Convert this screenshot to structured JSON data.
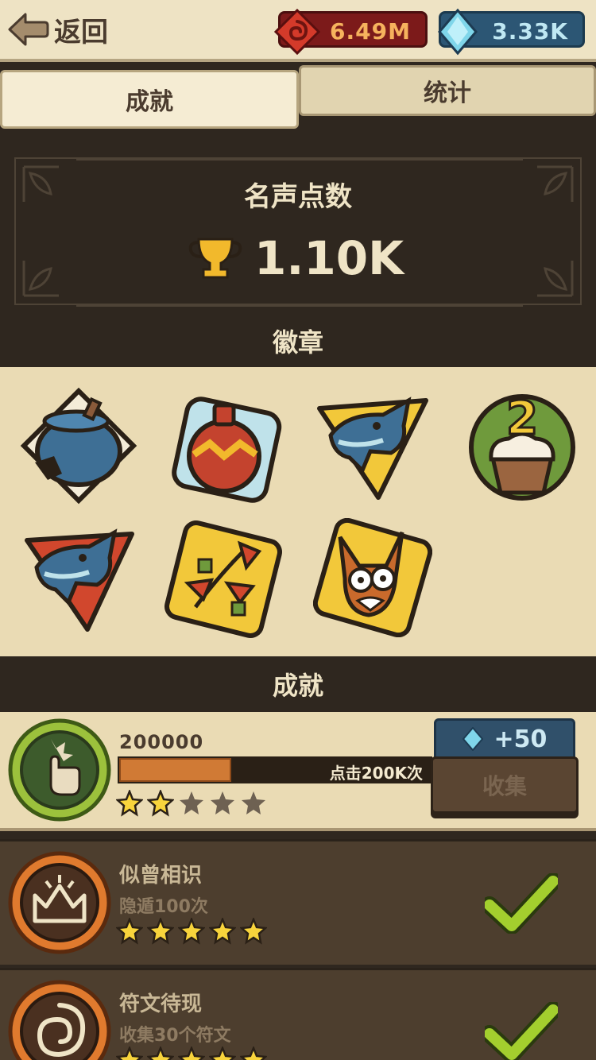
{
  "topbar": {
    "back_label": "返回",
    "currency_red": {
      "value": "6.49M",
      "icon": "red-rune-icon",
      "color": "#7c1a1a"
    },
    "currency_blue": {
      "value": "3.33K",
      "icon": "gem-icon",
      "color": "#2c5674"
    }
  },
  "tabs": [
    {
      "label": "成就",
      "active": true
    },
    {
      "label": "统计",
      "active": false
    }
  ],
  "fame": {
    "title": "名声点数",
    "value": "1.10K",
    "icon": "trophy-icon"
  },
  "badges": {
    "title": "徽章",
    "items": [
      "sack-badge-icon",
      "vase-badge-icon",
      "blue-dragon-badge-icon",
      "cupcake-badge-icon",
      "red-dragon-badge-icon",
      "flower-badge-icon",
      "fox-badge-icon"
    ]
  },
  "achievements": {
    "title": "成就",
    "active": {
      "count": "200000",
      "progress_text": "点击200K次",
      "progress": 0.36,
      "stars_filled": 2,
      "stars_total": 5,
      "reward_amount": "+50",
      "collect_label": "收集",
      "icon": "tap-hand-icon"
    },
    "completed": [
      {
        "name": "似曾相识",
        "desc": "隐遁100次",
        "stars_filled": 5,
        "icon": "crown-icon"
      },
      {
        "name": "符文待现",
        "desc": "收集30个符文",
        "stars_filled": 5,
        "icon": "rune-spiral-icon"
      }
    ]
  }
}
